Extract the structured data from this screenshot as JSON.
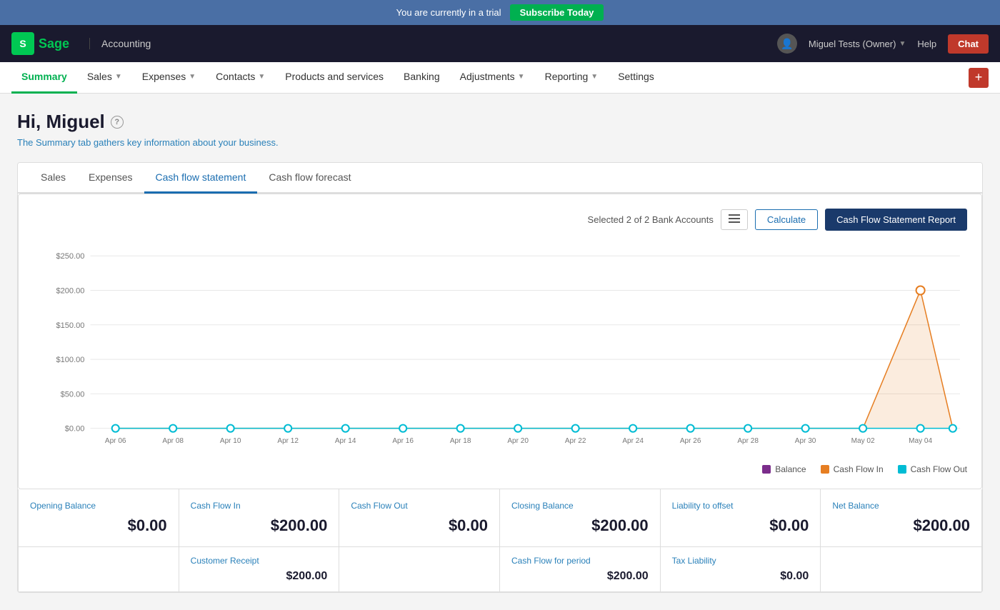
{
  "trial_bar": {
    "text": "You are currently in a trial",
    "subscribe_label": "Subscribe Today"
  },
  "top_nav": {
    "logo_text": "Sage",
    "accounting_label": "Accounting",
    "user_label": "Miguel Tests (Owner)",
    "help_label": "Help",
    "chat_label": "Chat"
  },
  "main_nav": {
    "items": [
      {
        "label": "Summary",
        "active": true
      },
      {
        "label": "Sales",
        "has_dropdown": true
      },
      {
        "label": "Expenses",
        "has_dropdown": true
      },
      {
        "label": "Contacts",
        "has_dropdown": true
      },
      {
        "label": "Products and services",
        "has_dropdown": false
      },
      {
        "label": "Banking",
        "has_dropdown": false
      },
      {
        "label": "Adjustments",
        "has_dropdown": true
      },
      {
        "label": "Reporting",
        "has_dropdown": true
      },
      {
        "label": "Settings",
        "has_dropdown": false
      }
    ],
    "plus_label": "+"
  },
  "page": {
    "greeting": "Hi, Miguel",
    "subtitle": "The Summary tab gathers key information about your business.",
    "help_tooltip": "?"
  },
  "content_tabs": [
    {
      "label": "Sales",
      "active": false
    },
    {
      "label": "Expenses",
      "active": false
    },
    {
      "label": "Cash flow statement",
      "active": true
    },
    {
      "label": "Cash flow forecast",
      "active": false
    }
  ],
  "chart": {
    "bank_accounts_text": "Selected 2 of 2 Bank Accounts",
    "calculate_label": "Calculate",
    "report_label": "Cash Flow Statement Report",
    "y_labels": [
      "$250.00",
      "$200.00",
      "$150.00",
      "$100.00",
      "$50.00",
      "$0.00"
    ],
    "x_labels": [
      "Apr 06",
      "Apr 08",
      "Apr 10",
      "Apr 12",
      "Apr 14",
      "Apr 16",
      "Apr 18",
      "Apr 20",
      "Apr 22",
      "Apr 24",
      "Apr 26",
      "Apr 28",
      "Apr 30",
      "May 02",
      "May 04"
    ],
    "legend": [
      {
        "label": "Balance",
        "color": "#7b2d8b"
      },
      {
        "label": "Cash Flow In",
        "color": "#e67e22"
      },
      {
        "label": "Cash Flow Out",
        "color": "#00bcd4"
      }
    ]
  },
  "summary_cards": [
    {
      "label": "Opening Balance",
      "value": "$0.00"
    },
    {
      "label": "Cash Flow In",
      "value": "$200.00"
    },
    {
      "label": "Cash Flow Out",
      "value": "$0.00"
    },
    {
      "label": "Closing Balance",
      "value": "$200.00"
    },
    {
      "label": "Liability to offset",
      "value": "$0.00"
    },
    {
      "label": "Net Balance",
      "value": "$200.00"
    }
  ],
  "sub_cards": [
    {
      "label": "",
      "value": ""
    },
    {
      "label": "Customer Receipt",
      "value": "$200.00"
    },
    {
      "label": "",
      "value": ""
    },
    {
      "label": "Cash Flow for period",
      "value": "$200.00"
    },
    {
      "label": "Tax Liability",
      "value": "$0.00"
    },
    {
      "label": "",
      "value": ""
    }
  ]
}
